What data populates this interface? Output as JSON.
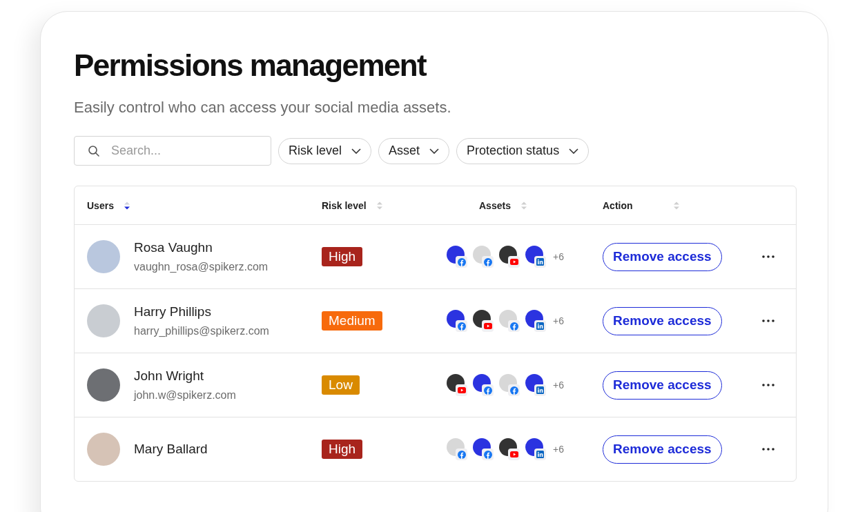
{
  "title": "Permissions management",
  "subtitle": "Easily control who can access your social media assets.",
  "search": {
    "placeholder": "Search..."
  },
  "filters": [
    {
      "label": "Risk level"
    },
    {
      "label": "Asset"
    },
    {
      "label": "Protection status"
    }
  ],
  "columns": [
    {
      "label": "Users",
      "sorted": true
    },
    {
      "label": "Risk level",
      "sorted": false
    },
    {
      "label": "Assets",
      "sorted": false
    },
    {
      "label": "Action",
      "sorted": false
    }
  ],
  "rows": [
    {
      "name": "Rosa Vaughn",
      "email": "vaughn_rosa@spikerz.com",
      "risk": {
        "label": "High",
        "kind": "high"
      },
      "assets": [
        {
          "color": "#2b33e0",
          "kind": "facebook"
        },
        {
          "color": "#d8d8d8",
          "kind": "facebook"
        },
        {
          "color": "#333333",
          "kind": "youtube"
        },
        {
          "color": "#2b33e0",
          "kind": "linkedin"
        }
      ],
      "more": "+6",
      "action": "Remove access"
    },
    {
      "name": "Harry Phillips",
      "email": "harry_phillips@spikerz.com",
      "risk": {
        "label": "Medium",
        "kind": "medium"
      },
      "assets": [
        {
          "color": "#2b33e0",
          "kind": "facebook"
        },
        {
          "color": "#333333",
          "kind": "youtube"
        },
        {
          "color": "#d8d8d8",
          "kind": "facebook"
        },
        {
          "color": "#2b33e0",
          "kind": "linkedin"
        }
      ],
      "more": "+6",
      "action": "Remove access"
    },
    {
      "name": "John Wright",
      "email": "john.w@spikerz.com",
      "risk": {
        "label": "Low",
        "kind": "low"
      },
      "assets": [
        {
          "color": "#333333",
          "kind": "youtube"
        },
        {
          "color": "#2b33e0",
          "kind": "facebook"
        },
        {
          "color": "#d8d8d8",
          "kind": "facebook"
        },
        {
          "color": "#2b33e0",
          "kind": "linkedin"
        }
      ],
      "more": "+6",
      "action": "Remove access"
    },
    {
      "name": "Mary Ballard",
      "risk": {
        "label": "High",
        "kind": "high"
      },
      "assets": [
        {
          "color": "#d8d8d8",
          "kind": "facebook"
        },
        {
          "color": "#2b33e0",
          "kind": "facebook"
        },
        {
          "color": "#333333",
          "kind": "youtube"
        },
        {
          "color": "#2b33e0",
          "kind": "linkedin"
        }
      ],
      "more": "+6",
      "action": "Remove access"
    }
  ]
}
